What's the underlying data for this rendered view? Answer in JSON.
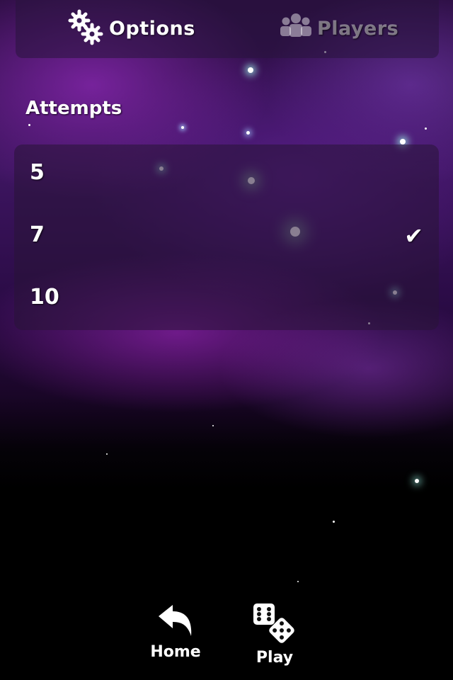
{
  "tabs": [
    {
      "label": "Options",
      "icon": "gears-icon",
      "active": true
    },
    {
      "label": "Players",
      "icon": "group-icon",
      "active": false
    }
  ],
  "section": {
    "title": "Attempts"
  },
  "attempts": [
    {
      "label": "5",
      "selected": false
    },
    {
      "label": "7",
      "selected": true
    },
    {
      "label": "10",
      "selected": false
    }
  ],
  "check_glyph": "✔",
  "toolbar": {
    "home_label": "Home",
    "play_label": "Play"
  }
}
